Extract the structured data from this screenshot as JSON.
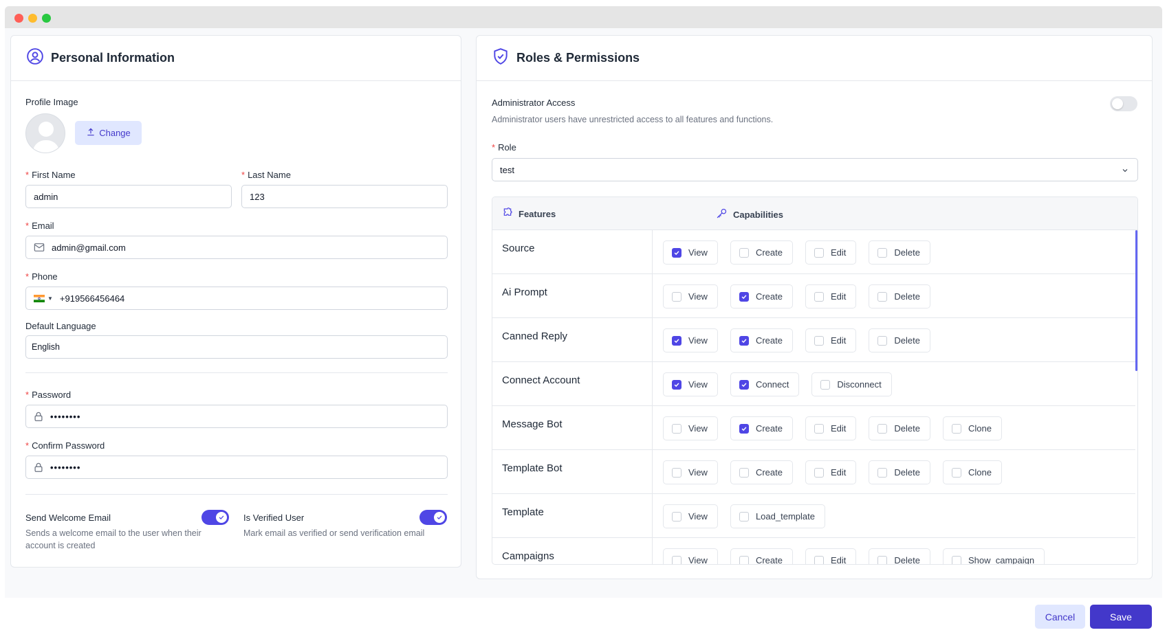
{
  "personal": {
    "title": "Personal Information",
    "profile_image_label": "Profile Image",
    "change_label": "Change",
    "first_name_label": "First Name",
    "first_name_value": "admin",
    "last_name_label": "Last Name",
    "last_name_value": "123",
    "email_label": "Email",
    "email_value": "admin@gmail.com",
    "phone_label": "Phone",
    "phone_value": "+919566456464",
    "language_label": "Default Language",
    "language_value": "English",
    "password_label": "Password",
    "password_value": "••••••••",
    "confirm_password_label": "Confirm Password",
    "confirm_password_value": "••••••••",
    "welcome_email_label": "Send Welcome Email",
    "welcome_email_help": "Sends a welcome email to the user when their account is created",
    "welcome_email_on": true,
    "verified_label": "Is Verified User",
    "verified_help": "Mark email as verified or send verification email",
    "verified_on": true
  },
  "roles": {
    "title": "Roles & Permissions",
    "admin_access_label": "Administrator Access",
    "admin_access_help": "Administrator users have unrestricted access to all features and functions.",
    "admin_access_on": false,
    "role_label": "Role",
    "role_value": "test",
    "features_header": "Features",
    "capabilities_header": "Capabilities",
    "rows": [
      {
        "feature": "Source",
        "caps": [
          {
            "label": "View",
            "checked": true
          },
          {
            "label": "Create",
            "checked": false
          },
          {
            "label": "Edit",
            "checked": false
          },
          {
            "label": "Delete",
            "checked": false
          }
        ]
      },
      {
        "feature": "Ai Prompt",
        "caps": [
          {
            "label": "View",
            "checked": false
          },
          {
            "label": "Create",
            "checked": true
          },
          {
            "label": "Edit",
            "checked": false
          },
          {
            "label": "Delete",
            "checked": false
          }
        ]
      },
      {
        "feature": "Canned Reply",
        "caps": [
          {
            "label": "View",
            "checked": true
          },
          {
            "label": "Create",
            "checked": true
          },
          {
            "label": "Edit",
            "checked": false
          },
          {
            "label": "Delete",
            "checked": false
          }
        ]
      },
      {
        "feature": "Connect Account",
        "caps": [
          {
            "label": "View",
            "checked": true
          },
          {
            "label": "Connect",
            "checked": true
          },
          {
            "label": "Disconnect",
            "checked": false
          }
        ]
      },
      {
        "feature": "Message Bot",
        "caps": [
          {
            "label": "View",
            "checked": false
          },
          {
            "label": "Create",
            "checked": true
          },
          {
            "label": "Edit",
            "checked": false
          },
          {
            "label": "Delete",
            "checked": false
          },
          {
            "label": "Clone",
            "checked": false
          }
        ]
      },
      {
        "feature": "Template Bot",
        "caps": [
          {
            "label": "View",
            "checked": false
          },
          {
            "label": "Create",
            "checked": false
          },
          {
            "label": "Edit",
            "checked": false
          },
          {
            "label": "Delete",
            "checked": false
          },
          {
            "label": "Clone",
            "checked": false
          }
        ]
      },
      {
        "feature": "Template",
        "caps": [
          {
            "label": "View",
            "checked": false
          },
          {
            "label": "Load_template",
            "checked": false
          }
        ]
      },
      {
        "feature": "Campaigns",
        "caps": [
          {
            "label": "View",
            "checked": false
          },
          {
            "label": "Create",
            "checked": false
          },
          {
            "label": "Edit",
            "checked": false
          },
          {
            "label": "Delete",
            "checked": false
          },
          {
            "label": "Show_campaign",
            "checked": false
          }
        ]
      }
    ]
  },
  "footer": {
    "cancel_label": "Cancel",
    "save_label": "Save"
  },
  "colors": {
    "accent": "#4f46e5",
    "accent_light": "#e0e7ff",
    "required": "#ef4444"
  }
}
